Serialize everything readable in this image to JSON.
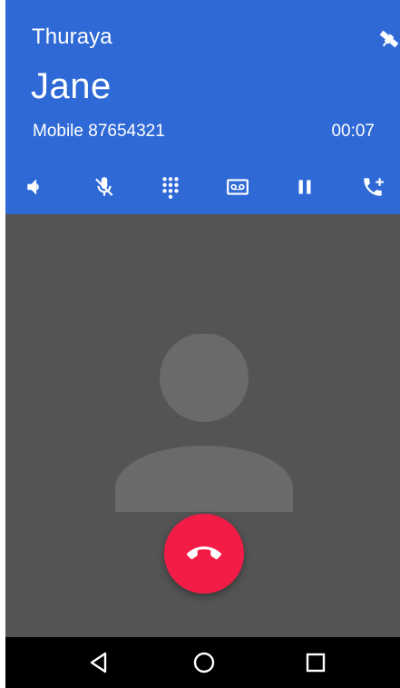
{
  "call": {
    "carrier": "Thuraya",
    "contact_name": "Jane",
    "number_label": "Mobile 87654321",
    "elapsed": "00:07"
  },
  "controls": [
    {
      "name": "speaker",
      "icon": "speaker-icon"
    },
    {
      "name": "mute",
      "icon": "mic-off-icon"
    },
    {
      "name": "dialpad",
      "icon": "dialpad-icon"
    },
    {
      "name": "voicemail",
      "icon": "voicemail-icon"
    },
    {
      "name": "hold",
      "icon": "pause-icon"
    },
    {
      "name": "add-call",
      "icon": "add-call-icon"
    }
  ],
  "status_icons": {
    "satellite": "satellite-icon"
  },
  "end_call": {
    "icon": "call-end-icon"
  },
  "navigation": {
    "back": "back-icon",
    "home": "home-icon",
    "recents": "recents-icon"
  },
  "colors": {
    "header": "#2f69d6",
    "background": "#545454",
    "end_call": "#f21c46",
    "avatar": "#6a6a6a",
    "navbar": "#000000"
  }
}
